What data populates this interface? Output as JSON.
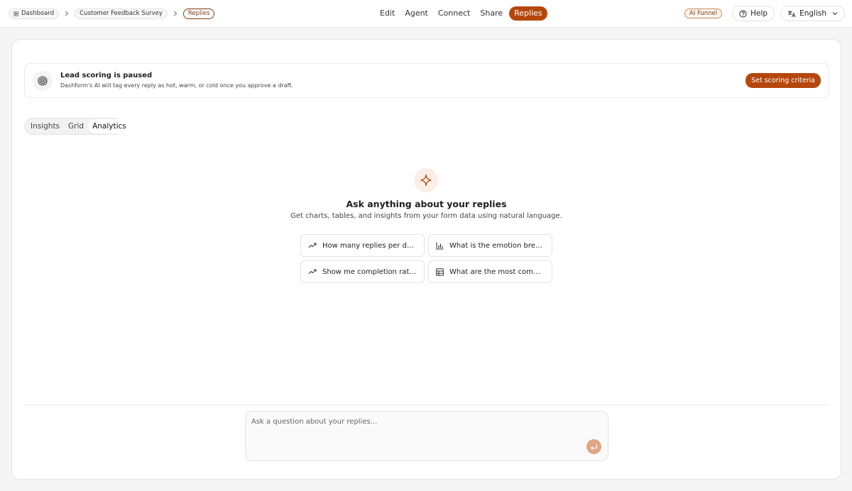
{
  "breadcrumb": {
    "items": [
      {
        "label": "Dashboard"
      },
      {
        "label": "Customer Feedback Survey"
      },
      {
        "label": "Replies"
      }
    ]
  },
  "nav": {
    "items": [
      {
        "label": "Edit"
      },
      {
        "label": "Agent"
      },
      {
        "label": "Connect"
      },
      {
        "label": "Share"
      },
      {
        "label": "Replies",
        "active": true
      }
    ]
  },
  "toolbar": {
    "ai_funnel_label": "AI Funnel",
    "help_label": "Help",
    "language_label": "English"
  },
  "banner": {
    "title": "Lead scoring is paused",
    "subtitle": "Dashform's AI will tag every reply as hot, warm, or cold once you approve a draft.",
    "button_label": "Set scoring criteria"
  },
  "tabs": [
    {
      "label": "Insights"
    },
    {
      "label": "Grid"
    },
    {
      "label": "Analytics",
      "active": true
    }
  ],
  "empty_state": {
    "title": "Ask anything about your replies",
    "subtitle": "Get charts, tables, and insights from your form data using natural language."
  },
  "suggestions": [
    {
      "label": "How many replies per day did I get?",
      "icon": "trend-icon"
    },
    {
      "label": "What is the emotion breakdown?",
      "icon": "bar-chart-icon"
    },
    {
      "label": "Show me completion rate over time",
      "icon": "trend-icon"
    },
    {
      "label": "What are the most common answers?",
      "icon": "table-icon"
    }
  ],
  "ask": {
    "placeholder": "Ask a question about your replies...",
    "value": ""
  },
  "colors": {
    "accent": "#b5470d",
    "accent_soft": "#e0a684"
  }
}
